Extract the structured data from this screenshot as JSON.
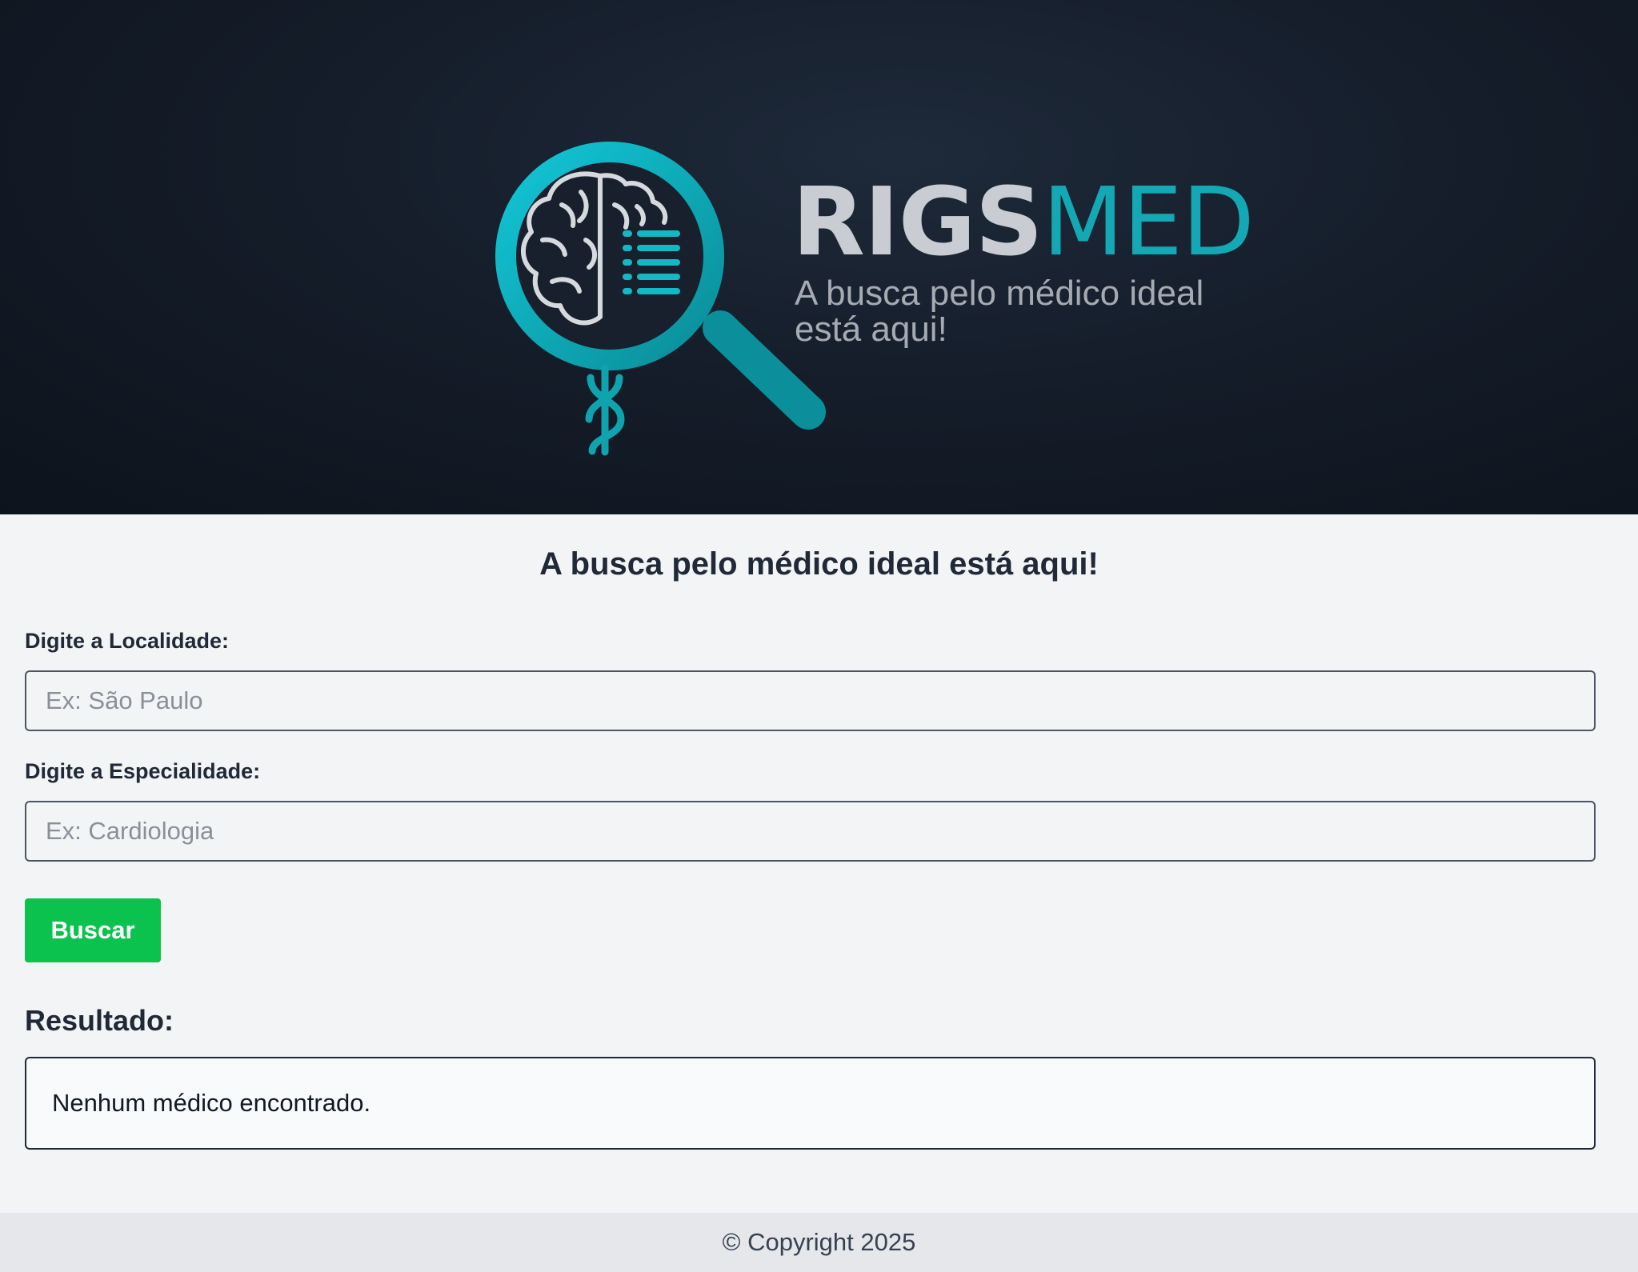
{
  "hero": {
    "brand_part1": "RIGS",
    "brand_part2": "MED",
    "tagline_line1": "A busca pelo médico ideal",
    "tagline_line2": "está aqui!",
    "logo_icon": "magnifier-brain-caduceus-icon",
    "accent_color": "#13a8b4"
  },
  "main": {
    "title": "A busca pelo médico ideal está aqui!",
    "location": {
      "label": "Digite a Localidade:",
      "placeholder": "Ex: São Paulo",
      "value": ""
    },
    "specialty": {
      "label": "Digite a Especialidade:",
      "placeholder": "Ex: Cardiologia",
      "value": ""
    },
    "search_button_label": "Buscar",
    "search_button_color": "#0cc24f",
    "result_heading": "Resultado:",
    "result_text": "Nenhum médico encontrado."
  },
  "footer": {
    "copyright": "© Copyright 2025"
  }
}
